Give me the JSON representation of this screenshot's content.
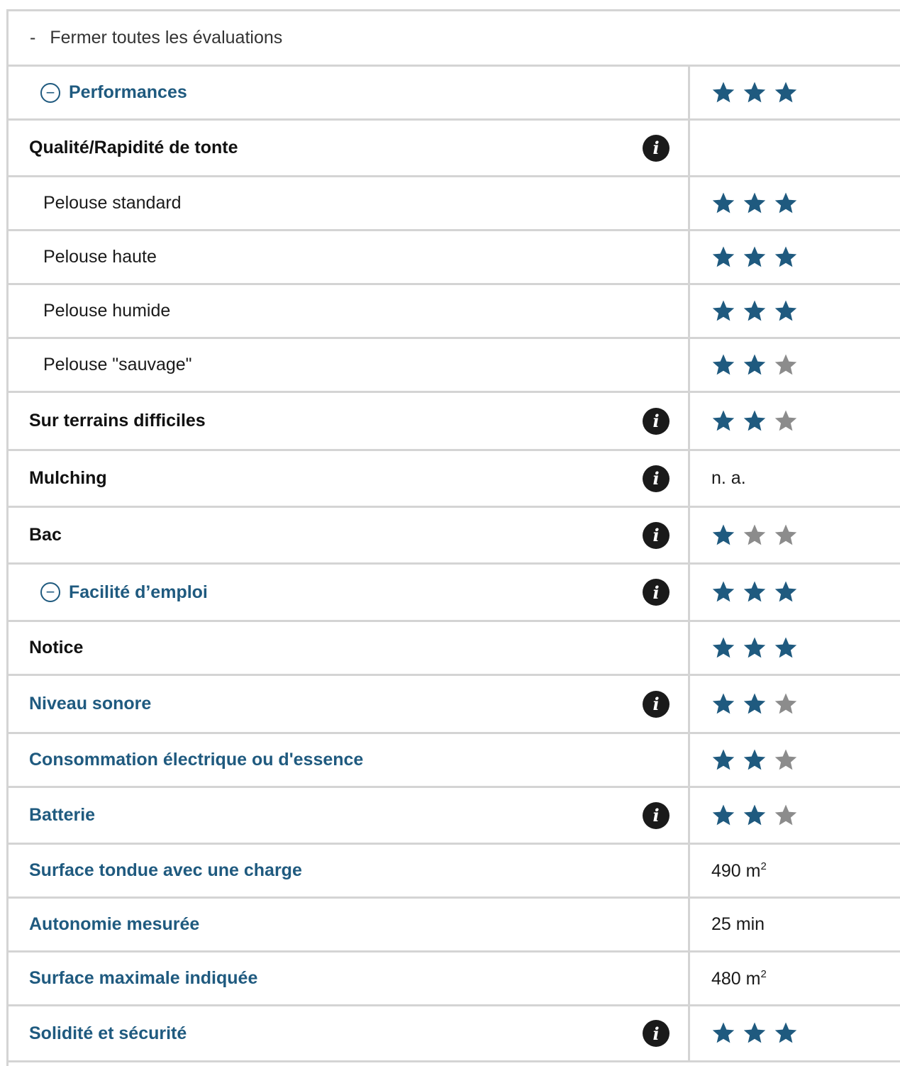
{
  "colors": {
    "star_on": "#1f5a7f",
    "star_off": "#8c8c8c",
    "accent": "#1f5a7f"
  },
  "header": {
    "dash": "-",
    "close_all": "Fermer toutes les évaluations"
  },
  "rows": [
    {
      "type": "section",
      "label": "Performances",
      "icon": "minus-circle-icon",
      "rating": 3,
      "height": 73
    },
    {
      "type": "bold",
      "label": "Qualité/Rapidité de tonte",
      "info": true,
      "height": 77
    },
    {
      "type": "sub",
      "label": "Pelouse standard",
      "rating": 3,
      "height": 73
    },
    {
      "type": "sub",
      "label": "Pelouse haute",
      "rating": 3,
      "height": 73
    },
    {
      "type": "sub",
      "label": "Pelouse humide",
      "rating": 3,
      "height": 73
    },
    {
      "type": "sub",
      "label": "Pelouse \"sauvage\"",
      "rating": 2,
      "height": 73
    },
    {
      "type": "bold",
      "label": "Sur terrains difficiles",
      "info": true,
      "rating": 2,
      "height": 79
    },
    {
      "type": "bold",
      "label": "Mulching",
      "info": true,
      "value": "n. a.",
      "height": 77
    },
    {
      "type": "bold",
      "label": "Bac",
      "info": true,
      "rating": 1,
      "height": 77
    },
    {
      "type": "section",
      "label": "Facilité d’emploi",
      "icon": "minus-circle-icon",
      "info": true,
      "rating": 3,
      "height": 78
    },
    {
      "type": "bold",
      "label": "Notice",
      "rating": 3,
      "height": 73
    },
    {
      "type": "link",
      "label": "Niveau sonore",
      "info": true,
      "rating": 2,
      "height": 79
    },
    {
      "type": "link",
      "label": "Consommation électrique ou d'essence",
      "rating": 2,
      "height": 73
    },
    {
      "type": "link",
      "label": "Batterie",
      "info": true,
      "rating": 2,
      "height": 77
    },
    {
      "type": "link",
      "label": "Surface tondue avec une charge",
      "value": "490 m",
      "value_sup": "2",
      "height": 73
    },
    {
      "type": "link",
      "label": "Autonomie mesurée",
      "value": "25 min",
      "height": 73
    },
    {
      "type": "link",
      "label": "Surface maximale indiquée",
      "value": "480 m",
      "value_sup": "2",
      "height": 73
    },
    {
      "type": "link",
      "label": "Solidité et sécurité",
      "info": true,
      "rating": 3,
      "height": 76
    }
  ],
  "rating_max": 3,
  "info_glyph": "i"
}
